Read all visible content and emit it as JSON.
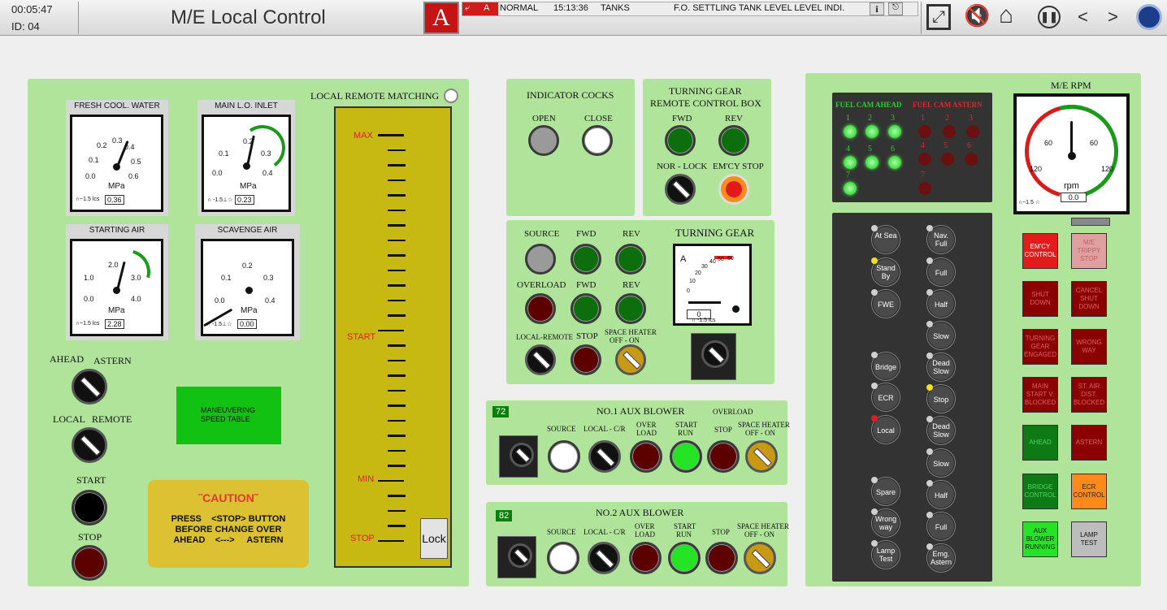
{
  "header": {
    "elapsed": "00:05:47",
    "id_label": "ID:  04",
    "title": "M/E Local Control",
    "alarm_logo": "A",
    "alarm_tag": "A",
    "alarm_status": "NORMAL",
    "alarm_time": "15:13:36",
    "alarm_group": "TANKS",
    "alarm_message": "F.O. SETTLING TANK LEVEL LEVEL INDI.",
    "info_icon": "i"
  },
  "nav": {
    "prev": "<",
    "next": ">"
  },
  "left": {
    "gauges": {
      "fcw": {
        "title": "FRESH COOL. WATER",
        "unit": "MPa",
        "value": "0.36",
        "ticks": [
          "0.0",
          "0.1",
          "0.2",
          "0.3",
          "0.4",
          "0.5",
          "0.6"
        ],
        "class": "∩~1.5 lcs"
      },
      "lo": {
        "title": "MAIN L.O. INLET",
        "unit": "MPa",
        "value": "0.23",
        "ticks": [
          "0.0",
          "0.1",
          "0.2",
          "0.3",
          "0.4"
        ],
        "class": "∩ -1.5⊥☆"
      },
      "sa": {
        "title": "STARTING AIR",
        "unit": "MPa",
        "value": "2.28",
        "ticks": [
          "0.0",
          "1.0",
          "2.0",
          "3.0",
          "4.0"
        ],
        "class": "∩~1.5 lcs"
      },
      "sc": {
        "title": "SCAVENGE AIR",
        "unit": "MPa",
        "value": "0.00",
        "ticks": [
          "0.0",
          "0.1",
          "0.2",
          "0.3",
          "0.4"
        ],
        "class": "∩ -1.5⊥☆"
      }
    },
    "ahead": "AHEAD",
    "astern": "ASTERN",
    "local": "LOCAL",
    "remote": "REMOTE",
    "start": "START",
    "stop": "STOP",
    "speed_table": "MANEUVERING SPEED TABLE",
    "caution_title": "˝CAUTION˝",
    "caution_line1": "PRESS    <STOP> BUTTON",
    "caution_line2": "BEFORE CHANGE OVER",
    "caution_line3": "AHEAD    <--->     ASTERN",
    "matching": "LOCAL REMOTE MATCHING",
    "scale_max": "MAX",
    "scale_start": "START",
    "scale_min": "MIN",
    "scale_stop": "STOP",
    "lock": "Lock"
  },
  "ind": {
    "title": "INDICATOR COCKS",
    "open": "OPEN",
    "close": "CLOSE"
  },
  "tgbox": {
    "title1": "TURNING GEAR",
    "title2": "REMOTE CONTROL BOX",
    "fwd": "FWD",
    "rev": "REV",
    "norlock": "NOR - LOCK",
    "emcy": "EM'CY STOP"
  },
  "tg": {
    "source": "SOURCE",
    "fwd": "FWD",
    "rev": "REV",
    "overload": "OVERLOAD",
    "fwd2": "FWD",
    "rev2": "REV",
    "local_remote": "LOCAL-REMOTE",
    "stop": "STOP",
    "heater1": "SPACE HEATER",
    "heater2": "OFF - ON",
    "meter_title": "TURNING GEAR",
    "meter_unit": "A",
    "meter_value": "0",
    "meter_ticks": [
      "0",
      "10",
      "20",
      "30",
      "40",
      "50",
      "60"
    ],
    "meter_class": "∩ -1.5 lcs"
  },
  "ab1": {
    "num": "72",
    "title": "NO.1 AUX BLOWER",
    "overload_hdr": "OVERLOAD",
    "source": "SOURCE",
    "local": "LOCAL - C/R",
    "over1": "OVER",
    "over2": "LOAD",
    "start1": "START",
    "start2": "RUN",
    "stop": "STOP",
    "heat1": "SPACE HEATER",
    "heat2": "OFF - ON"
  },
  "ab2": {
    "num": "82",
    "title": "NO.2 AUX BLOWER",
    "source": "SOURCE",
    "local": "LOCAL - C/R",
    "over1": "OVER",
    "over2": "LOAD",
    "start1": "START",
    "start2": "RUN",
    "stop": "STOP",
    "heat1": "SPACE HEATER",
    "heat2": "OFF - ON"
  },
  "cam": {
    "ahead_title": "FUEL CAM AHEAD",
    "astern_title": "FUEL CAM ASTERN",
    "numbers": [
      "1",
      "2",
      "3",
      "4",
      "5",
      "6",
      "7"
    ]
  },
  "tele": {
    "left": [
      "At Sea",
      "Stand By",
      "FWE",
      "Bridge",
      "ECR",
      "Local",
      "Spare",
      "Wrong way",
      "Lamp Test"
    ],
    "right": [
      "Nav. Full",
      "Full",
      "Half",
      "Slow",
      "Dead Slow",
      "Stop",
      "Dead Slow",
      "Slow",
      "Half",
      "Full",
      "Emg. Astern"
    ]
  },
  "rpm": {
    "title": "M/E RPM",
    "unit": "rpm",
    "value": "0.0",
    "ticks": [
      "120",
      "60",
      "60",
      "120"
    ],
    "class": "∩~1.5 ☆"
  },
  "tiles": [
    {
      "label": "EM'CY CONTROL",
      "bg": "#e31b1b",
      "fg": "#fff"
    },
    {
      "label": "M/E TRIPPY STOP",
      "bg": "#e0a0a0",
      "fg": "#c06060"
    },
    {
      "label": "SHUT DOWN",
      "bg": "#8b0000",
      "fg": "#e06060"
    },
    {
      "label": "CANCEL SHUT DOWN",
      "bg": "#8b0000",
      "fg": "#e06060"
    },
    {
      "label": "TURNING GEAR ENGAGED",
      "bg": "#8b0000",
      "fg": "#e06060"
    },
    {
      "label": "WRONG WAY",
      "bg": "#8b0000",
      "fg": "#e06060"
    },
    {
      "label": "MAIN START V. BLOCKED",
      "bg": "#8b0000",
      "fg": "#e06060"
    },
    {
      "label": "ST. AIR DIST. BLOCKED",
      "bg": "#8b0000",
      "fg": "#e06060"
    },
    {
      "label": "AHEAD",
      "bg": "#0d7a15",
      "fg": "#4fd65f"
    },
    {
      "label": "ASTERN",
      "bg": "#8b0000",
      "fg": "#e06060"
    },
    {
      "label": "BRIDGE CONTROL",
      "bg": "#0d7a15",
      "fg": "#4fd65f"
    },
    {
      "label": "ECR CONTROL",
      "bg": "#ff8a1a",
      "fg": "#222"
    },
    {
      "label": "AUX BLOWER RUNNING",
      "bg": "#25e325",
      "fg": "#111"
    },
    {
      "label": "LAMP TEST",
      "bg": "#bdbdbd",
      "fg": "#111"
    }
  ]
}
